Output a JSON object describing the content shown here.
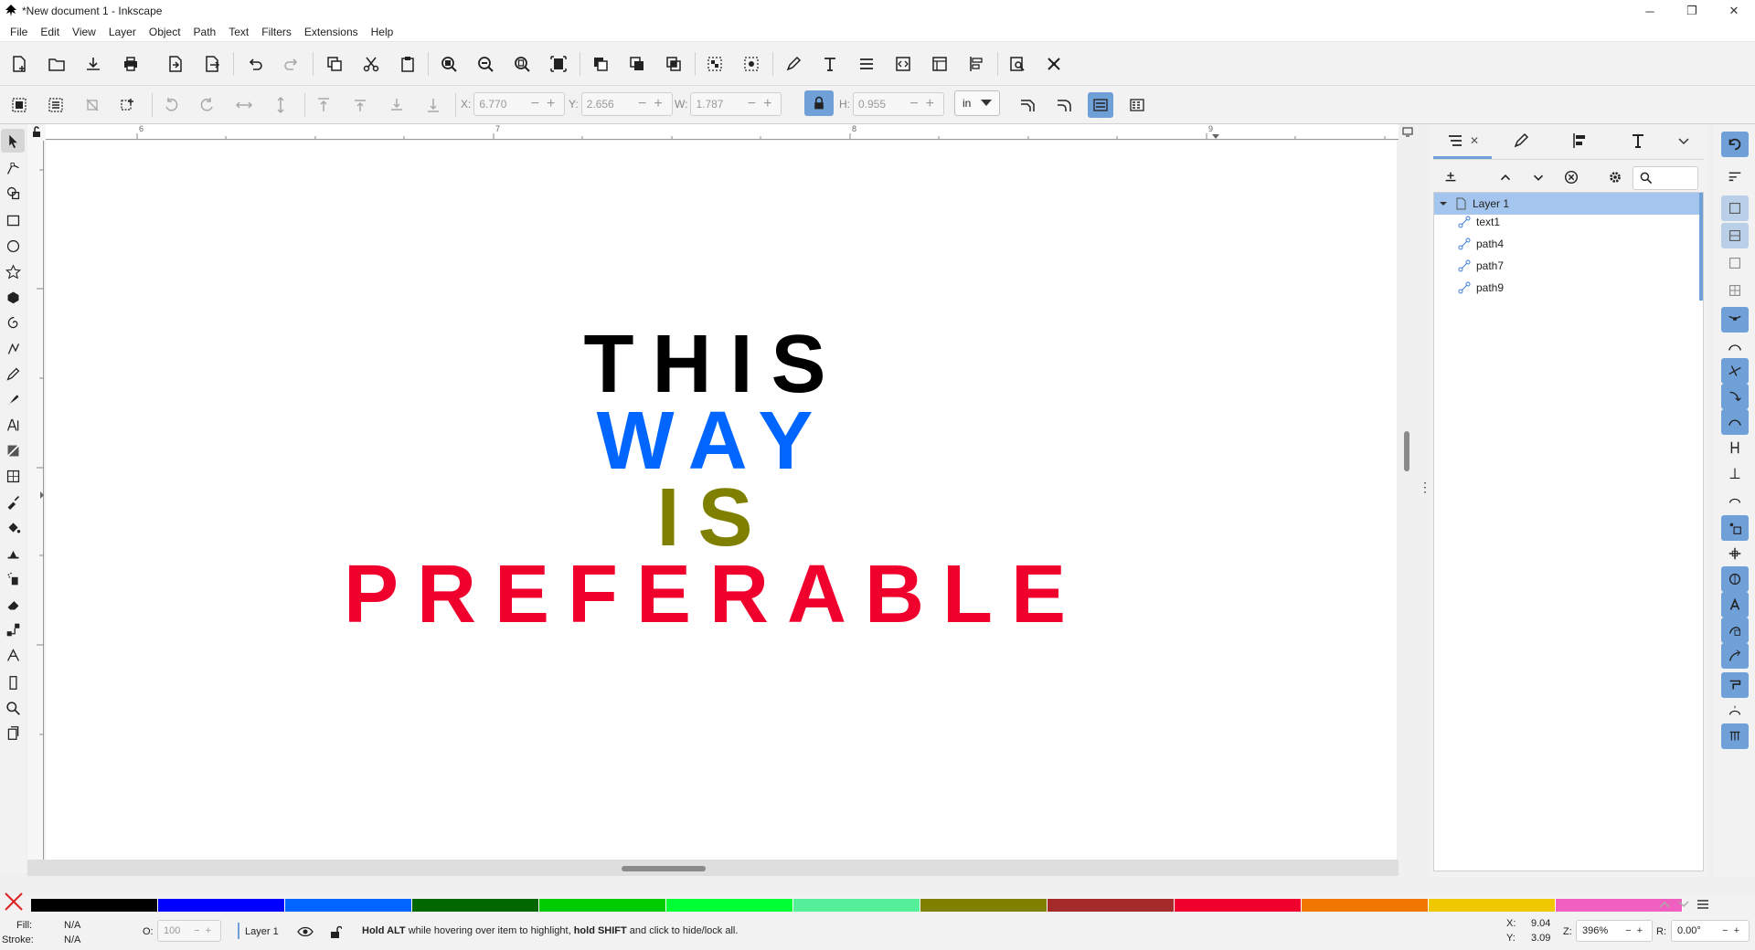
{
  "window": {
    "title": "*New document 1 - Inkscape",
    "min": "─",
    "max": "❐",
    "close": "✕"
  },
  "menu": [
    "File",
    "Edit",
    "View",
    "Layer",
    "Object",
    "Path",
    "Text",
    "Filters",
    "Extensions",
    "Help"
  ],
  "controls": {
    "x": {
      "label": "X:",
      "value": "6.770"
    },
    "y": {
      "label": "Y:",
      "value": "2.656"
    },
    "w": {
      "label": "W:",
      "value": "1.787"
    },
    "h": {
      "label": "H:",
      "value": "0.955"
    },
    "units": "in"
  },
  "ruler": {
    "labels": [
      "6",
      "7",
      "8",
      "9"
    ]
  },
  "canvas_text": [
    {
      "text": "THIS",
      "color": "#000000"
    },
    {
      "text": "WAY",
      "color": "#0066ff"
    },
    {
      "text": "IS",
      "color": "#808000"
    },
    {
      "text": "PREFERABLE",
      "color": "#f0002c"
    }
  ],
  "layers": {
    "search_placeholder": "",
    "items": [
      {
        "label": "Layer 1"
      },
      {
        "label": "text1"
      },
      {
        "label": "path4"
      },
      {
        "label": "path7"
      },
      {
        "label": "path9"
      }
    ]
  },
  "palette": [
    "#000000",
    "#0000ff",
    "#0066ff",
    "#006600",
    "#00cc00",
    "#00ff33",
    "#55ee99",
    "#808000",
    "#a52a2a",
    "#f0002c",
    "#f07800",
    "#f0c800",
    "#f060c0"
  ],
  "status": {
    "fill_label": "Fill:",
    "fill_value": "N/A",
    "stroke_label": "Stroke:",
    "stroke_value": "N/A",
    "opacity_label": "O:",
    "opacity_value": "100",
    "layer": "Layer 1",
    "msg_b1": "Hold ALT",
    "msg_t1": " while hovering over item to highlight, ",
    "msg_b2": "hold SHIFT",
    "msg_t2": " and click to hide/lock all.",
    "cx_label": "X:",
    "cx": "9.04",
    "cy_label": "Y:",
    "cy": "3.09",
    "zoom_label": "Z:",
    "zoom": "396%",
    "rot_label": "R:",
    "rot": "0.00°"
  }
}
